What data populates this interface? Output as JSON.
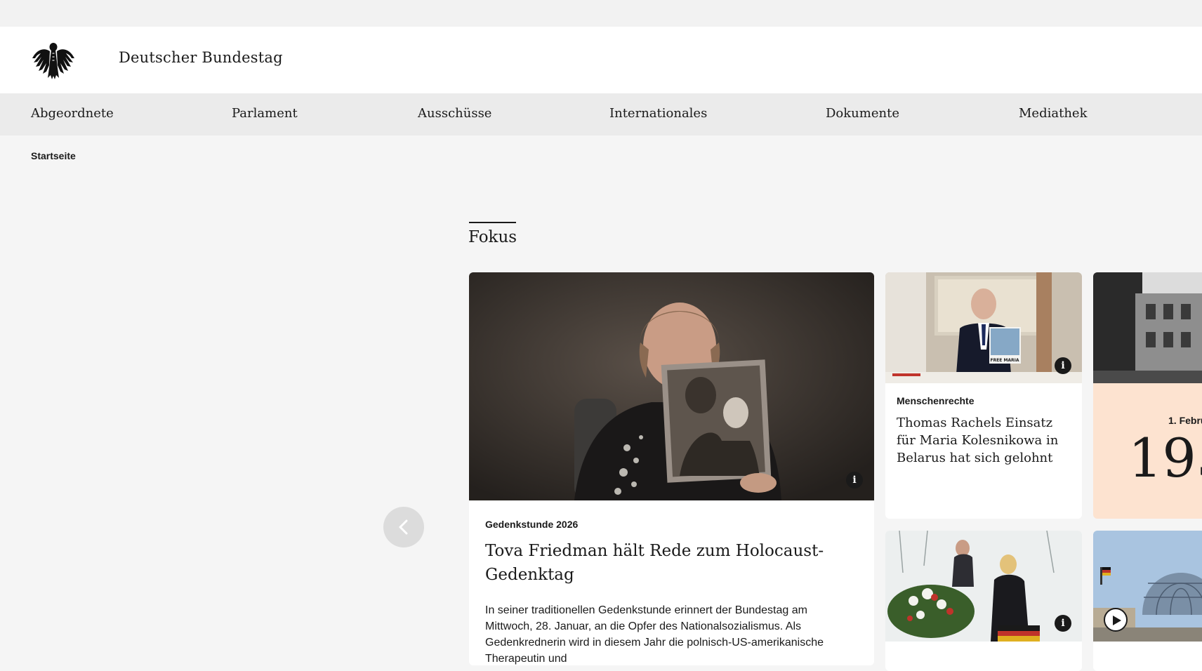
{
  "header": {
    "site_title": "Deutscher Bundestag"
  },
  "nav": {
    "items": [
      {
        "label": "Abgeordnete"
      },
      {
        "label": "Parlament"
      },
      {
        "label": "Ausschüsse"
      },
      {
        "label": "Internationales"
      },
      {
        "label": "Dokumente"
      },
      {
        "label": "Mediathek"
      }
    ]
  },
  "breadcrumb": {
    "home": "Startseite"
  },
  "focus": {
    "section_title": "Fokus",
    "main_card": {
      "kicker": "Gedenkstunde 2026",
      "headline": "Tova Friedman hält Rede zum Holocaust-Gedenktag",
      "teaser": "In seiner traditionellen Gedenkstunde erinnert der Bundestag am Mittwoch, 28. Januar, an die Opfer des Nationalsozialismus. Als Gedenkrednerin wird in diesem Jahr die polnisch-US-amerikanische Therapeutin und",
      "image_info_icon": "info-icon"
    },
    "card_rachel": {
      "kicker": "Menschenrechte",
      "headline": "Thomas Rachels Einsatz für Maria Kolesnikowa in Belarus hat sich gelohnt",
      "image_sign": "FREE MARIA",
      "image_info_icon": "info-icon"
    },
    "card_date": {
      "date_label": "1. Febru",
      "year": "195"
    },
    "card_snow": {
      "image_info_icon": "info-icon"
    },
    "card_reichstag": {
      "image_play_icon": "play-icon"
    }
  },
  "colors": {
    "accent_peach": "#fde3d0",
    "text": "#1a1a1a",
    "background": "#f5f5f5"
  }
}
